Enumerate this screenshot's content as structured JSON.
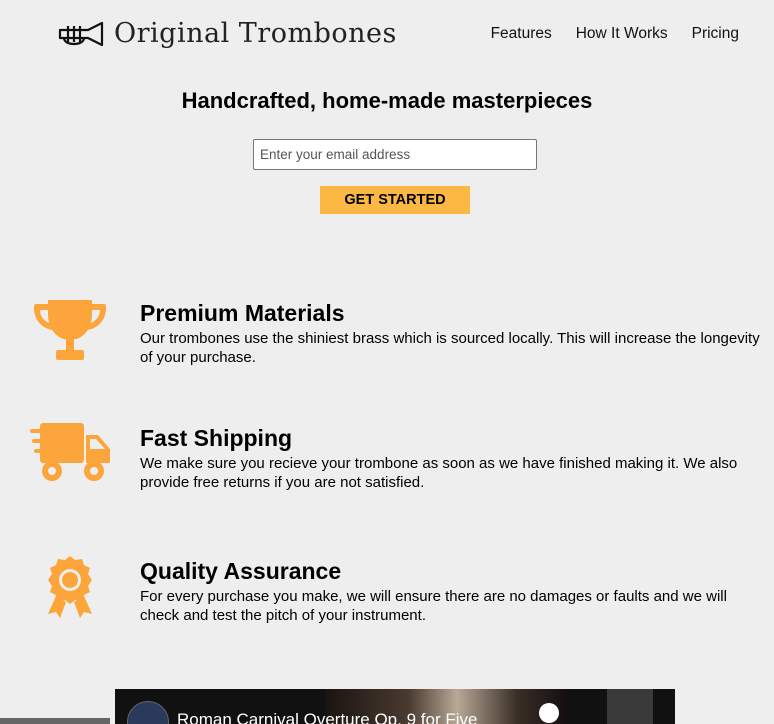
{
  "header": {
    "logo_text": "Original Trombones",
    "nav": [
      "Features",
      "How It Works",
      "Pricing"
    ]
  },
  "hero": {
    "title": "Handcrafted, home-made masterpieces",
    "email_placeholder": "Enter your email address",
    "cta_label": "GET STARTED"
  },
  "features": [
    {
      "icon": "trophy-icon",
      "title": "Premium Materials",
      "text": "Our trombones use the shiniest brass which is sourced locally. This will increase the longevity of your purchase."
    },
    {
      "icon": "shipping-truck-icon",
      "title": "Fast Shipping",
      "text": "We make sure you recieve your trombone as soon as we have finished making it. We also provide free returns if you are not satisfied."
    },
    {
      "icon": "award-badge-icon",
      "title": "Quality Assurance",
      "text": "For every purchase you make, we will ensure there are no damages or faults and we will check and test the pitch of your instrument."
    }
  ],
  "video": {
    "title": "Roman Carnival Overture Op. 9 for Five"
  },
  "colors": {
    "accent": "#fdb843",
    "icon": "#fba53a",
    "background": "#eeeeee"
  }
}
